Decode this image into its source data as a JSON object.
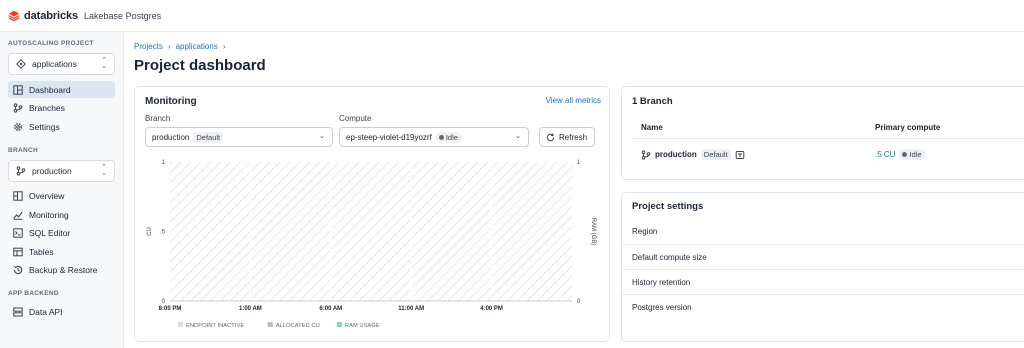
{
  "topbar": {
    "brand": "databricks",
    "product": "Lakebase Postgres"
  },
  "sidebar": {
    "project_section": "AUTOSCALING PROJECT",
    "project": "applications",
    "project_items": [
      {
        "label": "Dashboard",
        "icon": "dashboard-icon",
        "active": true
      },
      {
        "label": "Branches",
        "icon": "branch-icon",
        "active": false
      },
      {
        "label": "Settings",
        "icon": "gear-icon",
        "active": false
      }
    ],
    "branch_section": "BRANCH",
    "branch": "production",
    "branch_items": [
      {
        "label": "Overview",
        "icon": "overview-icon"
      },
      {
        "label": "Monitoring",
        "icon": "monitoring-icon"
      },
      {
        "label": "SQL Editor",
        "icon": "sql-editor-icon"
      },
      {
        "label": "Tables",
        "icon": "table-icon"
      },
      {
        "label": "Backup & Restore",
        "icon": "history-icon"
      }
    ],
    "backend_section": "APP BACKEND",
    "backend_items": [
      {
        "label": "Data API",
        "icon": "api-icon"
      }
    ]
  },
  "breadcrumb": {
    "items": [
      "Projects",
      "applications"
    ],
    "sep": "›"
  },
  "page": {
    "title": "Project dashboard"
  },
  "monitoring": {
    "title": "Monitoring",
    "view_all": "View all metrics",
    "branch_label": "Branch",
    "branch_value": "production",
    "branch_badge": "Default",
    "compute_label": "Compute",
    "compute_value": "ep-steep-violet-d19yozrf",
    "compute_status": "Idle",
    "refresh": "Refresh"
  },
  "chart_data": {
    "type": "area",
    "x_ticks": [
      "8:00 PM",
      "1:00 AM",
      "6:00 AM",
      "11:00 AM",
      "4:00 PM"
    ],
    "y_left": {
      "label": "CU",
      "ticks": [
        "0",
        ".5",
        "1"
      ],
      "ylim": [
        0,
        1
      ]
    },
    "y_right": {
      "label": "RAM (GB)",
      "ticks": [
        "0",
        "1"
      ],
      "ylim": [
        0,
        1
      ]
    },
    "legend": [
      "ENDPOINT INACTIVE",
      "ALLOCATED CU",
      "RAM USAGE"
    ],
    "legend_colors": [
      "#d9dde3",
      "#b8bec8",
      "#8fd4b0"
    ],
    "inactive_hatched": true,
    "series": []
  },
  "branches": {
    "title": "1 Branch",
    "col_name": "Name",
    "col_compute": "Primary compute",
    "rows": [
      {
        "name": "production",
        "badge": "Default",
        "compute": ".5 CU",
        "status": "Idle"
      }
    ]
  },
  "settings": {
    "title": "Project settings",
    "rows": [
      "Region",
      "Default compute size",
      "History retention",
      "Postgres version"
    ]
  },
  "colors": {
    "accent": "#2272b4",
    "active_nav": "#dce5f2",
    "brand": "#ff3621"
  }
}
